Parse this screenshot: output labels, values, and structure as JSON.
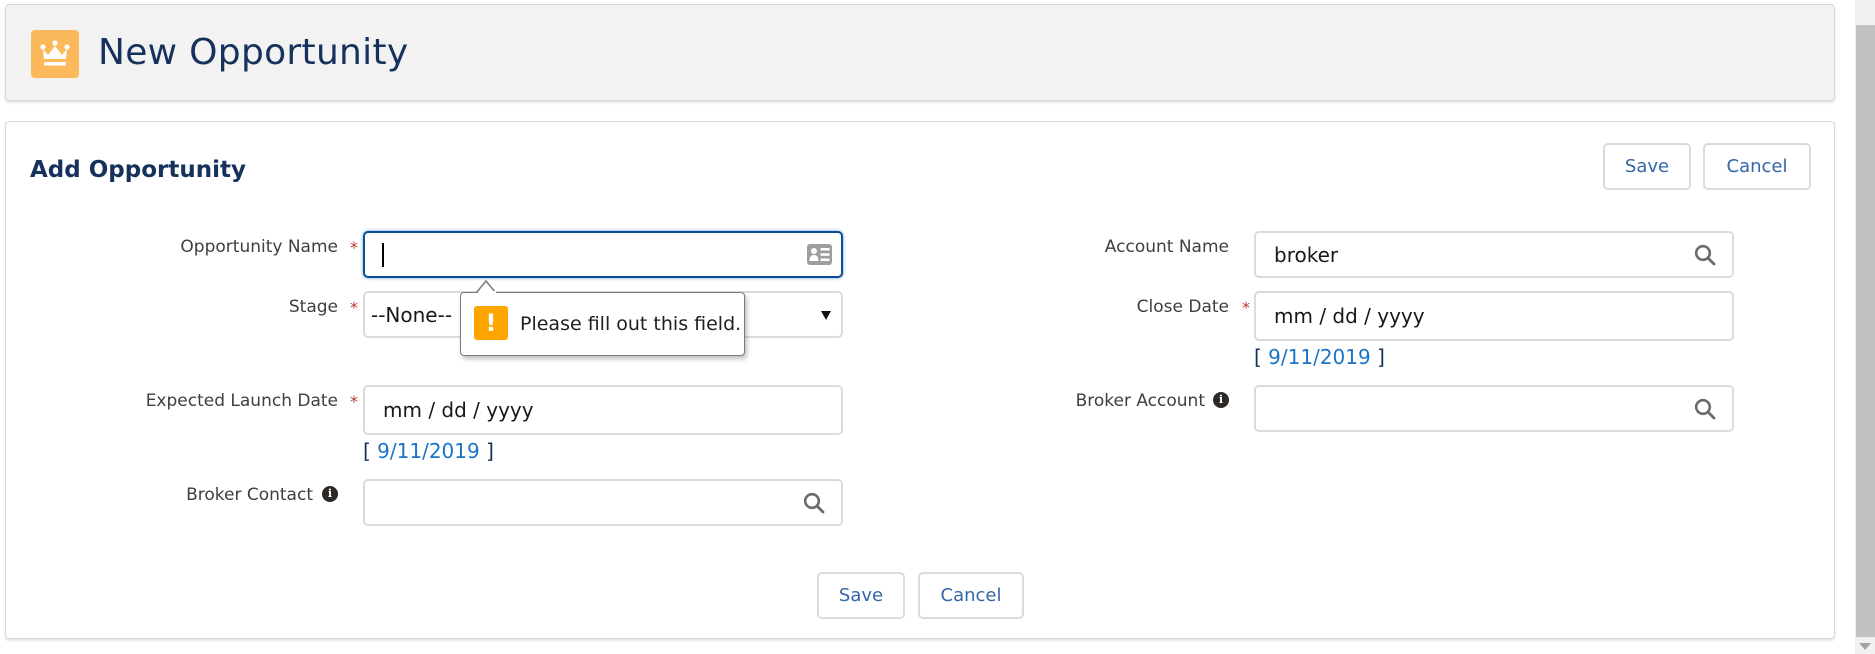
{
  "header": {
    "icon": "crown-icon",
    "icon_color": "#fcb95b",
    "title": "New Opportunity"
  },
  "panel": {
    "title": "Add Opportunity",
    "save_label": "Save",
    "cancel_label": "Cancel"
  },
  "form": {
    "opportunity_name": {
      "label": "Opportunity Name",
      "required": "*",
      "value": "",
      "icon": "contact-card-icon"
    },
    "stage": {
      "label": "Stage",
      "required": "*",
      "selected": "--None--",
      "icon": "dropdown-arrow-icon"
    },
    "expected_launch_date": {
      "label": "Expected Launch Date",
      "required": "*",
      "placeholder": "mm / dd / yyyy",
      "today_link": "9/11/2019",
      "bracket_open": "[",
      "bracket_close": "]"
    },
    "broker_contact": {
      "label": "Broker Contact",
      "value": "",
      "info_icon": "info-icon",
      "icon": "search-icon"
    },
    "account_name": {
      "label": "Account Name",
      "value": "broker",
      "icon": "search-icon"
    },
    "close_date": {
      "label": "Close Date",
      "required": "*",
      "placeholder": "mm / dd / yyyy",
      "today_link": "9/11/2019",
      "bracket_open": "[",
      "bracket_close": "]"
    },
    "broker_account": {
      "label": "Broker Account",
      "value": "",
      "info_icon": "info-icon",
      "icon": "search-icon"
    }
  },
  "validation_tooltip": {
    "icon": "warning-icon",
    "icon_glyph": "!",
    "icon_color": "#ffa500",
    "message": "Please fill out this field."
  },
  "footer": {
    "save_label": "Save",
    "cancel_label": "Cancel"
  },
  "info_glyph": "i",
  "colors": {
    "accent_text": "#16325c",
    "button_text": "#3566a8",
    "link": "#1b74c7",
    "required": "#c23934",
    "focus_border": "#0b4e96"
  }
}
